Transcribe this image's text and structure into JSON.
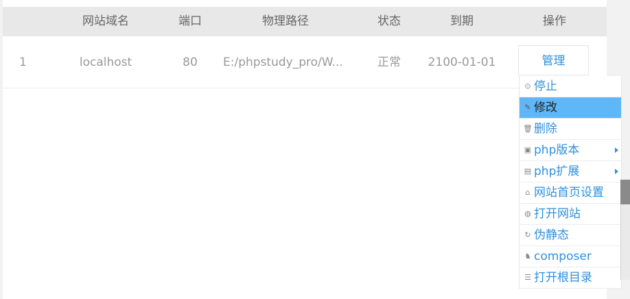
{
  "table": {
    "headers": {
      "index": "",
      "domain": "网站域名",
      "port": "端口",
      "path": "物理路径",
      "status": "状态",
      "expiry": "到期",
      "actions": "操作"
    },
    "rows": [
      {
        "index": "1",
        "domain": "localhost",
        "port": "80",
        "path": "E:/phpstudy_pro/W...",
        "status": "正常",
        "expiry": "2100-01-01",
        "action_label": "管理"
      }
    ]
  },
  "menu": {
    "items": [
      {
        "label": "停止",
        "icon": "stop-icon",
        "glyph": "⊙"
      },
      {
        "label": "修改",
        "icon": "pencil-icon",
        "glyph": "✎"
      },
      {
        "label": "删除",
        "icon": "trash-icon",
        "glyph": "🗑"
      },
      {
        "label": "php版本",
        "icon": "php-version-icon",
        "glyph": "▣"
      },
      {
        "label": "php扩展",
        "icon": "php-extension-icon",
        "glyph": "▤"
      },
      {
        "label": "网站首页设置",
        "icon": "home-icon",
        "glyph": "⌂"
      },
      {
        "label": "打开网站",
        "icon": "globe-icon",
        "glyph": "◍"
      },
      {
        "label": "伪静态",
        "icon": "refresh-icon",
        "glyph": "↻"
      },
      {
        "label": "composer",
        "icon": "composer-icon",
        "glyph": "♞"
      },
      {
        "label": "打开根目录",
        "icon": "list-icon",
        "glyph": "☰"
      }
    ],
    "active_label": "修改"
  },
  "colors": {
    "link": "#2f8fdd",
    "active_bg": "#5fb7f7",
    "header_bg": "#e8e8e8"
  }
}
